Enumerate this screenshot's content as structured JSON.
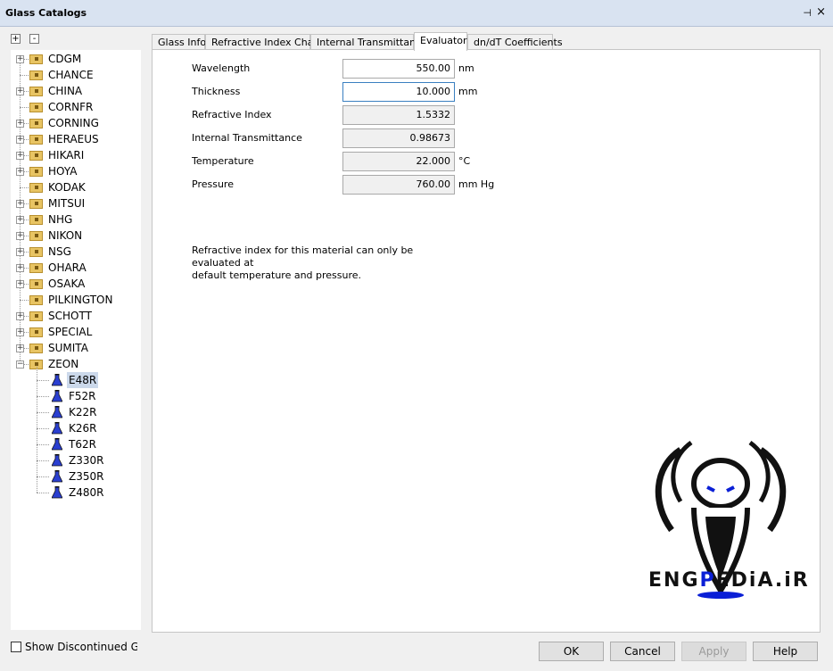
{
  "window": {
    "title": "Glass Catalogs",
    "pin_glyph": "⊣",
    "close_glyph": "×"
  },
  "tree_buttons": {
    "expand": "+",
    "collapse": "-"
  },
  "catalogs": [
    {
      "label": "CDGM",
      "expandable": true
    },
    {
      "label": "CHANCE",
      "expandable": false
    },
    {
      "label": "CHINA",
      "expandable": true
    },
    {
      "label": "CORNFR",
      "expandable": false
    },
    {
      "label": "CORNING",
      "expandable": true
    },
    {
      "label": "HERAEUS",
      "expandable": true
    },
    {
      "label": "HIKARI",
      "expandable": true
    },
    {
      "label": "HOYA",
      "expandable": true
    },
    {
      "label": "KODAK",
      "expandable": false
    },
    {
      "label": "MITSUI",
      "expandable": true
    },
    {
      "label": "NHG",
      "expandable": true
    },
    {
      "label": "NIKON",
      "expandable": true
    },
    {
      "label": "NSG",
      "expandable": true
    },
    {
      "label": "OHARA",
      "expandable": true
    },
    {
      "label": "OSAKA",
      "expandable": true
    },
    {
      "label": "PILKINGTON",
      "expandable": false
    },
    {
      "label": "SCHOTT",
      "expandable": true
    },
    {
      "label": "SPECIAL",
      "expandable": true
    },
    {
      "label": "SUMITA",
      "expandable": true
    },
    {
      "label": "ZEON",
      "expandable": true,
      "expanded": true
    }
  ],
  "zeon_children": [
    "E48R",
    "F52R",
    "K22R",
    "K26R",
    "T62R",
    "Z330R",
    "Z350R",
    "Z480R"
  ],
  "selected_child": "E48R",
  "show_discontinued": {
    "label": "Show Discontinued Glasses",
    "checked": false
  },
  "tabs": [
    {
      "label": "Glass Info"
    },
    {
      "label": "Refractive Index Chart"
    },
    {
      "label": "Internal Transmittance"
    },
    {
      "label": "Evaluator",
      "active": true
    },
    {
      "label": "dn/dT Coefficients"
    }
  ],
  "evaluator": {
    "fields": [
      {
        "label": "Wavelength",
        "value": "550.00",
        "unit": "nm",
        "readonly": false
      },
      {
        "label": "Thickness",
        "value": "10.000",
        "unit": "mm",
        "readonly": false,
        "focused": true
      },
      {
        "label": "Refractive Index",
        "value": "1.5332",
        "unit": "",
        "readonly": true
      },
      {
        "label": "Internal Transmittance",
        "value": "0.98673",
        "unit": "",
        "readonly": true
      },
      {
        "label": "Temperature",
        "value": "22.000",
        "unit": "°C",
        "readonly": true
      },
      {
        "label": "Pressure",
        "value": "760.00",
        "unit": "mm Hg",
        "readonly": true
      }
    ],
    "note_line1": "Refractive index for this material can only be evaluated at",
    "note_line2": "default temperature and pressure."
  },
  "watermark": {
    "text_a": "ENG",
    "text_b": "P",
    "text_c": "EDiA.iR"
  },
  "buttons": {
    "ok": "OK",
    "cancel": "Cancel",
    "apply": "Apply",
    "help": "Help"
  },
  "colors": {
    "folder": "#e8c463",
    "flask": "#2a3fd0",
    "focus": "#3a7fc0",
    "logo_accent": "#0a1fd6"
  }
}
